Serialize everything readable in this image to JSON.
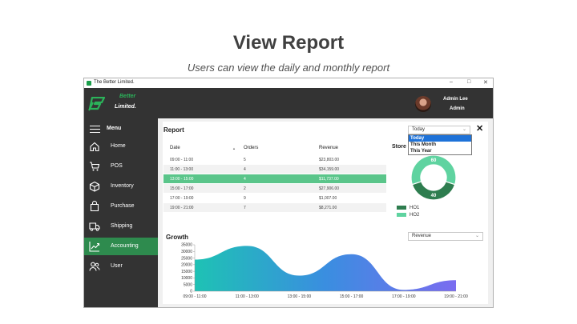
{
  "slide": {
    "title": "View Report",
    "subtitle": "Users can view the daily and monthly report"
  },
  "window": {
    "title": "The Better Limited.",
    "controls": [
      "–",
      "□",
      "✕"
    ]
  },
  "header": {
    "brand_line1": "Better",
    "brand_line2": "Limited.",
    "user_name": "Admin Lee",
    "user_role": "Admin"
  },
  "sidebar": {
    "menu_label": "Menu",
    "items": [
      {
        "label": "Home",
        "icon": "home-icon"
      },
      {
        "label": "POS",
        "icon": "cart-icon"
      },
      {
        "label": "Inventory",
        "icon": "box-icon"
      },
      {
        "label": "Purchase",
        "icon": "bag-icon"
      },
      {
        "label": "Shipping",
        "icon": "truck-icon"
      },
      {
        "label": "Accounting",
        "icon": "trend-icon",
        "active": true
      },
      {
        "label": "User",
        "icon": "users-icon"
      }
    ]
  },
  "report": {
    "title": "Report",
    "period_selected": "Today",
    "period_options": [
      "Today",
      "This Month",
      "This Year"
    ],
    "columns": {
      "date": "Date",
      "sort": "▲",
      "orders": "Orders",
      "revenue": "Revenue"
    },
    "rows": [
      {
        "date": "09:00 - 11:00",
        "orders": "5",
        "revenue": "$23,803.00"
      },
      {
        "date": "11:00 - 13:00",
        "orders": "4",
        "revenue": "$34,159.00"
      },
      {
        "date": "13:00 - 15:00",
        "orders": "4",
        "revenue": "$11,737.00",
        "selected": true
      },
      {
        "date": "15:00 - 17:00",
        "orders": "2",
        "revenue": "$27,906.00"
      },
      {
        "date": "17:00 - 19:00",
        "orders": "9",
        "revenue": "$1,007.00"
      },
      {
        "date": "19:00 - 21:00",
        "orders": "7",
        "revenue": "$8,271.00"
      }
    ]
  },
  "store": {
    "title": "Store",
    "slices": [
      {
        "name": "HO1",
        "value": 40,
        "color": "#2e7d4f"
      },
      {
        "name": "HO2",
        "value": 60,
        "color": "#5fd3a0"
      }
    ]
  },
  "growth": {
    "title": "Growth",
    "metric_selected": "Revenue"
  },
  "colors": {
    "accent": "#2e8b4e",
    "dark": "#333333",
    "selected_row": "#5ac58a"
  },
  "chart_data": {
    "type": "area",
    "title": "Growth",
    "x": [
      "09:00 - 11:00",
      "11:00 - 13:00",
      "13:00 - 15:00",
      "15:00 - 17:00",
      "17:00 - 19:00",
      "19:00 - 21:00"
    ],
    "series": [
      {
        "name": "Revenue",
        "values": [
          23803,
          34159,
          11737,
          27906,
          1007,
          8271
        ]
      }
    ],
    "yticks": [
      0,
      5000,
      10000,
      15000,
      20000,
      25000,
      30000,
      35000
    ],
    "ylim": [
      0,
      35000
    ],
    "grid": false
  }
}
